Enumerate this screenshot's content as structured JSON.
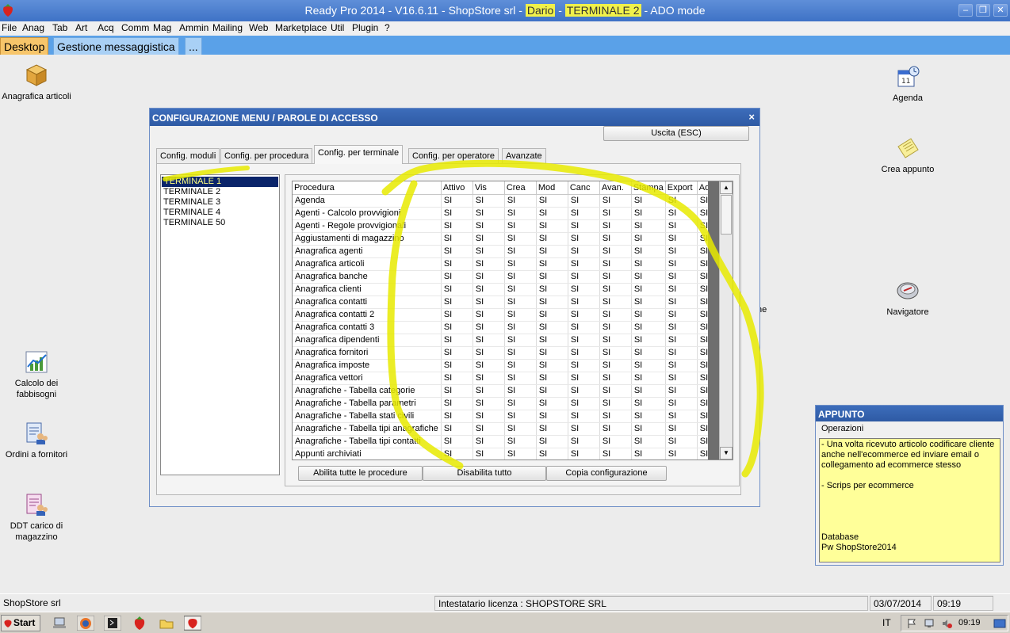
{
  "window": {
    "title_prefix": "Ready Pro 2014 - V16.6.11 - ShopStore srl - ",
    "user": "Dario",
    "sep": " - ",
    "terminal": "TERMINALE 2",
    "mode": " - ADO mode",
    "min": "–",
    "restore": "❐",
    "close": "✕"
  },
  "menu": [
    "File",
    "Anag",
    "Tab",
    "Art",
    "Acq",
    "Comm",
    "Mag",
    "Ammin",
    "Mailing",
    "Web",
    "Marketplace",
    "Util",
    "Plugin",
    "?"
  ],
  "doc_tabs": [
    "Desktop",
    "Gestione messaggistica",
    "..."
  ],
  "desktop_icons": {
    "anagrafica_articoli": "Anagrafica articoli",
    "agenda": "Agenda",
    "crea_appunto": "Crea appunto",
    "navigatore": "Navigatore",
    "calcolo_fabbisogni": "Calcolo dei fabbisogni",
    "ordini_fornitori": "Ordini a fornitori",
    "ddt_carico": "DDT carico di magazzino",
    "hidden_fragment": "he"
  },
  "dialog": {
    "title": "CONFIGURAZIONE MENU / PAROLE DI ACCESSO",
    "close": "×",
    "exit_button": "Uscita (ESC)",
    "tabs": [
      "Config. moduli",
      "Config. per procedura",
      "Config. per terminale",
      "Config. per operatore",
      "Avanzate"
    ],
    "active_tab": "Config. per terminale",
    "terminals": [
      "TERMINALE 1",
      "TERMINALE 2",
      "TERMINALE 3",
      "TERMINALE 4",
      "TERMINALE 50"
    ],
    "selected_terminal": "TERMINALE 1",
    "columns": [
      "Procedura",
      "Attivo",
      "Vis",
      "Crea",
      "Mod",
      "Canc",
      "Avan.",
      "Stampa",
      "Export",
      "Admin"
    ],
    "cell_value": "SI",
    "procedures": [
      "Agenda",
      "Agenti - Calcolo provvigioni",
      "Agenti - Regole provvigionali",
      "Aggiustamenti di magazzino",
      "Anagrafica agenti",
      "Anagrafica articoli",
      "Anagrafica banche",
      "Anagrafica clienti",
      "Anagrafica contatti",
      "Anagrafica contatti 2",
      "Anagrafica contatti 3",
      "Anagrafica dipendenti",
      "Anagrafica fornitori",
      "Anagrafica imposte",
      "Anagrafica vettori",
      "Anagrafiche - Tabella categorie",
      "Anagrafiche - Tabella parametri",
      "Anagrafiche - Tabella stati civili",
      "Anagrafiche - Tabella tipi anagrafiche",
      "Anagrafiche - Tabella tipi contatti",
      "Appunti archiviati"
    ],
    "buttons": {
      "enable_all": "Abilita tutte le procedure",
      "disable_all": "Disabilita tutto",
      "copy_config": "Copia configurazione"
    }
  },
  "appunto": {
    "title": "APPUNTO",
    "operations": "Operazioni",
    "note_lines": [
      "- Una volta ricevuto articolo codificare cliente",
      "anche nell'ecommerce ed inviare email o",
      "collegamento ad ecommerce stesso",
      "",
      "- Scrips per ecommerce",
      "",
      "",
      "",
      "",
      "Database",
      "Pw ShopStore2014"
    ]
  },
  "statusbar": {
    "company": "ShopStore srl",
    "license": "Intestatario licenza : SHOPSTORE SRL",
    "date": "03/07/2014",
    "time": "09:19"
  },
  "taskbar": {
    "start": "Start",
    "lang": "IT",
    "clock": "09:19"
  },
  "colors": {
    "annotation_yellow": "#e8ea00",
    "titlebar": "#3e72c6",
    "note_bg": "#ffff99"
  }
}
